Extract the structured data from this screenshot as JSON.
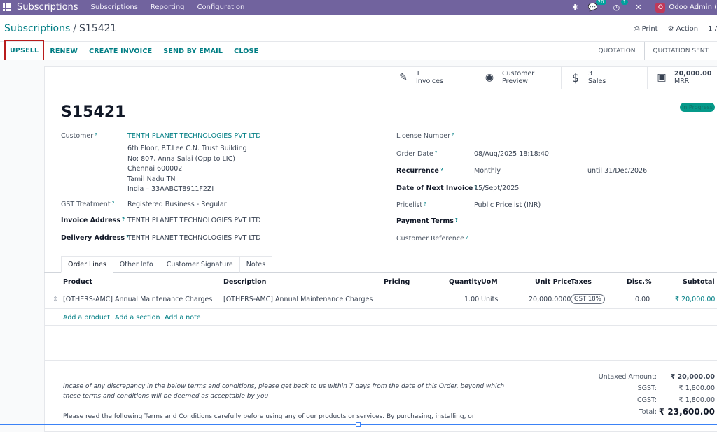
{
  "navbar": {
    "brand": "Subscriptions",
    "menus": [
      "Subscriptions",
      "Reporting",
      "Configuration"
    ],
    "messages_badge": "20",
    "activities_badge": "1",
    "user_initial": "O",
    "user": "Odoo Admin ("
  },
  "breadcrumb": {
    "parent": "Subscriptions",
    "separator": "/",
    "current": "S15421"
  },
  "control": {
    "print": "Print",
    "action": "Action",
    "pager": "1 /"
  },
  "actions": [
    "UPSELL",
    "RENEW",
    "CREATE INVOICE",
    "SEND BY EMAIL",
    "CLOSE"
  ],
  "stages": [
    "QUOTATION",
    "QUOTATION SENT"
  ],
  "smart_buttons": [
    {
      "icon": "edit-icon",
      "value": "1",
      "label": "Invoices"
    },
    {
      "icon": "globe-icon",
      "value": "Customer",
      "label": "Preview"
    },
    {
      "icon": "dollar-icon",
      "value": "3",
      "label": "Sales"
    },
    {
      "icon": "money-icon",
      "value": "20,000.00",
      "label": "MRR"
    }
  ],
  "record": {
    "title": "S15421",
    "status": "In Progress",
    "customer_label": "Customer",
    "customer": "TENTH PLANET TECHNOLOGIES PVT LTD",
    "address": [
      "6th Floor, P.T.Lee C.N. Trust Building",
      "No: 807, Anna Salai (Opp to LIC)",
      "Chennai 600002",
      "Tamil Nadu TN",
      "India – 33AABCT8911F2ZI"
    ],
    "gst_label": "GST Treatment",
    "gst": "Registered Business - Regular",
    "invoice_address_label": "Invoice Address",
    "invoice_address": "TENTH PLANET TECHNOLOGIES PVT LTD",
    "delivery_address_label": "Delivery Address",
    "delivery_address": "TENTH PLANET TECHNOLOGIES PVT LTD",
    "license_label": "License Number",
    "order_date_label": "Order Date",
    "order_date": "08/Aug/2025 18:18:40",
    "recurrence_label": "Recurrence",
    "recurrence": "Monthly",
    "until": "until 31/Dec/2026",
    "next_invoice_label": "Date of Next Invoice",
    "next_invoice": "15/Sept/2025",
    "pricelist_label": "Pricelist",
    "pricelist": "Public Pricelist (INR)",
    "payment_terms_label": "Payment Terms",
    "customer_ref_label": "Customer Reference"
  },
  "tabs": [
    "Order Lines",
    "Other Info",
    "Customer Signature",
    "Notes"
  ],
  "table": {
    "headers": [
      "Product",
      "Description",
      "Pricing",
      "Quantity",
      "UoM",
      "Unit Price",
      "Taxes",
      "Disc.%",
      "Subtotal"
    ],
    "row": {
      "product": "[OTHERS-AMC] Annual Maintenance Charges",
      "description": "[OTHERS-AMC] Annual Maintenance Charges",
      "quantity": "1.00",
      "uom": "Units",
      "unit_price": "20,000.0000",
      "tax": "GST 18%",
      "discount": "0.00",
      "subtotal": "₹ 20,000.00"
    },
    "add_product": "Add a product",
    "add_section": "Add a section",
    "add_note": "Add a note"
  },
  "totals": {
    "untaxed_label": "Untaxed Amount:",
    "untaxed": "₹ 20,000.00",
    "sgst_label": "SGST:",
    "sgst": "₹ 1,800.00",
    "cgst_label": "CGST:",
    "cgst": "₹ 1,800.00",
    "total_label": "Total:",
    "total": "₹ 23,600.00"
  },
  "terms": {
    "line1": "Incase of any discrepancy in the below terms and conditions, please get back to us within 7 days from the date of this Order, beyond which",
    "line2": "these terms and conditions will be deemed as acceptable by you",
    "line3": "Please read the following Terms and Conditions carefully before using any of our products or services. By purchasing, installing, or"
  },
  "colors": {
    "navbar": "#71639e",
    "link": "#017e84",
    "highlight": "#b91c1c"
  }
}
